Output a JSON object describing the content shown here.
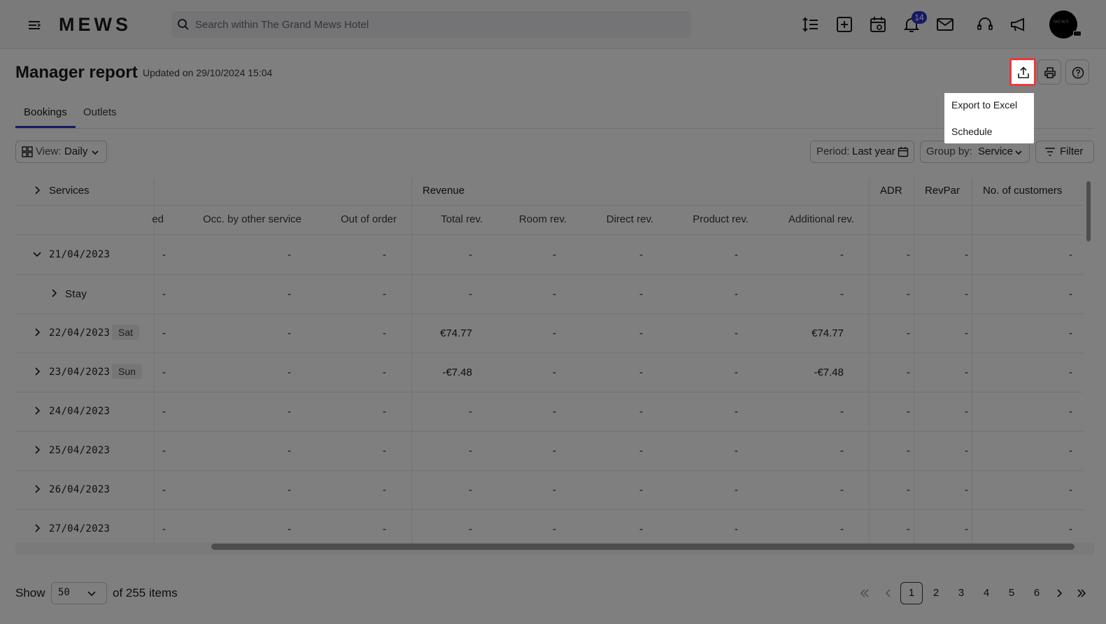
{
  "app": {
    "logo": "MEWS",
    "search_placeholder": "Search within The Grand Mews Hotel",
    "notifications_count": "14",
    "avatar_text": "MEWS"
  },
  "header": {
    "title": "Manager report",
    "updated": "Updated on 29/10/2024 15:04"
  },
  "export_menu": {
    "items": [
      "Export to Excel",
      "Schedule"
    ]
  },
  "tabs": [
    "Bookings",
    "Outlets"
  ],
  "controls": {
    "view_label": "View:",
    "view_value": "Daily",
    "period_label": "Period:",
    "period_value": "Last year",
    "group_label": "Group by:",
    "group_value": "Service",
    "filter": "Filter"
  },
  "table": {
    "group_headers": {
      "services": "Services",
      "revenue": "Revenue",
      "adr": "ADR",
      "revpar": "RevPar",
      "customers": "No. of customers"
    },
    "sub_headers": [
      "ed",
      "Occ. by other service",
      "Out of order",
      "Total rev.",
      "Room rev.",
      "Direct rev.",
      "Product rev.",
      "Additional rev."
    ],
    "rows": [
      {
        "date": "21/04/2023",
        "day": "",
        "expanded": true,
        "cells": [
          "-",
          "-",
          "-",
          "-",
          "-",
          "-",
          "-",
          "-",
          "-",
          "-",
          "-"
        ]
      },
      {
        "date": "Stay",
        "day": "",
        "child": true,
        "cells": [
          "-",
          "-",
          "-",
          "-",
          "-",
          "-",
          "-",
          "-",
          "-",
          "-",
          "-"
        ]
      },
      {
        "date": "22/04/2023",
        "day": "Sat",
        "cells": [
          "-",
          "-",
          "-",
          "€74.77",
          "-",
          "-",
          "-",
          "€74.77",
          "-",
          "-",
          "-"
        ]
      },
      {
        "date": "23/04/2023",
        "day": "Sun",
        "cells": [
          "-",
          "-",
          "-",
          "-€7.48",
          "-",
          "-",
          "-",
          "-€7.48",
          "-",
          "-",
          "-"
        ]
      },
      {
        "date": "24/04/2023",
        "day": "",
        "cells": [
          "-",
          "-",
          "-",
          "-",
          "-",
          "-",
          "-",
          "-",
          "-",
          "-",
          "-"
        ]
      },
      {
        "date": "25/04/2023",
        "day": "",
        "cells": [
          "-",
          "-",
          "-",
          "-",
          "-",
          "-",
          "-",
          "-",
          "-",
          "-",
          "-"
        ]
      },
      {
        "date": "26/04/2023",
        "day": "",
        "cells": [
          "-",
          "-",
          "-",
          "-",
          "-",
          "-",
          "-",
          "-",
          "-",
          "-",
          "-"
        ]
      },
      {
        "date": "27/04/2023",
        "day": "",
        "cells": [
          "-",
          "-",
          "-",
          "-",
          "-",
          "-",
          "-",
          "-",
          "-",
          "-",
          "-"
        ]
      }
    ]
  },
  "footer": {
    "show_label": "Show",
    "page_size": "50",
    "items_text": "of 255 items",
    "pages": [
      "1",
      "2",
      "3",
      "4",
      "5",
      "6"
    ],
    "current_page": "1"
  }
}
